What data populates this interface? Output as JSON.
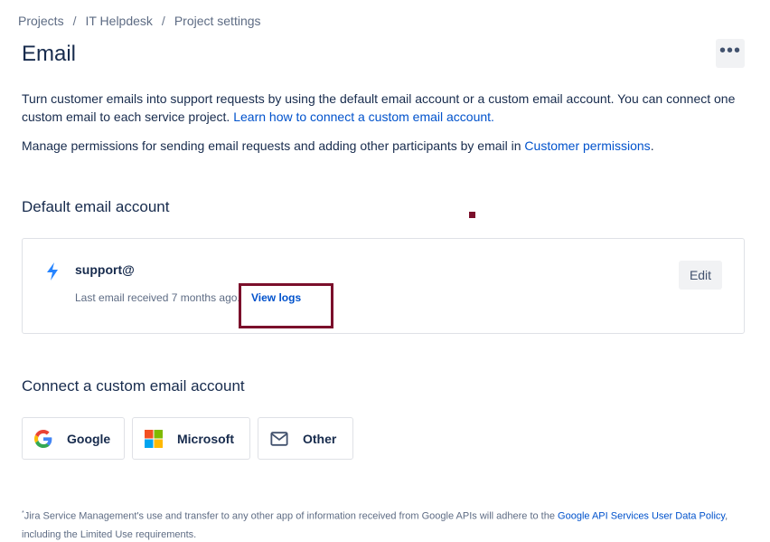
{
  "breadcrumb": {
    "items": [
      "Projects",
      "IT Helpdesk",
      "Project settings"
    ],
    "separator": "/"
  },
  "page": {
    "title": "Email",
    "more_label": "•••"
  },
  "intro": {
    "text": "Turn customer emails into support requests by using the default email account or a custom email account. You can connect one custom email to each service project. ",
    "link": "Learn how to connect a custom email account."
  },
  "permissions": {
    "text": "Manage permissions for sending email requests and adding other participants by email in ",
    "link": "Customer permissions",
    "suffix": "."
  },
  "default_account": {
    "heading": "Default email account",
    "email": "support@",
    "last_received": "Last email received 7 months ago.",
    "view_logs": "View logs",
    "edit": "Edit",
    "icon": "lightning-bolt-icon"
  },
  "custom_account": {
    "heading": "Connect a custom email account",
    "providers": [
      {
        "label": "Google",
        "icon": "google-icon"
      },
      {
        "label": "Microsoft",
        "icon": "microsoft-icon"
      },
      {
        "label": "Other",
        "icon": "mail-icon"
      }
    ]
  },
  "footnote": {
    "marker": "*",
    "text": "Jira Service Management's use and transfer to any other app of information received from Google APIs will adhere to the ",
    "link": "Google API Services User Data Policy",
    "suffix": ", including the Limited Use requirements."
  },
  "colors": {
    "link": "#0052cc",
    "text": "#172b4d",
    "subtle": "#5e6c84",
    "annotation": "#7b0f2b"
  }
}
